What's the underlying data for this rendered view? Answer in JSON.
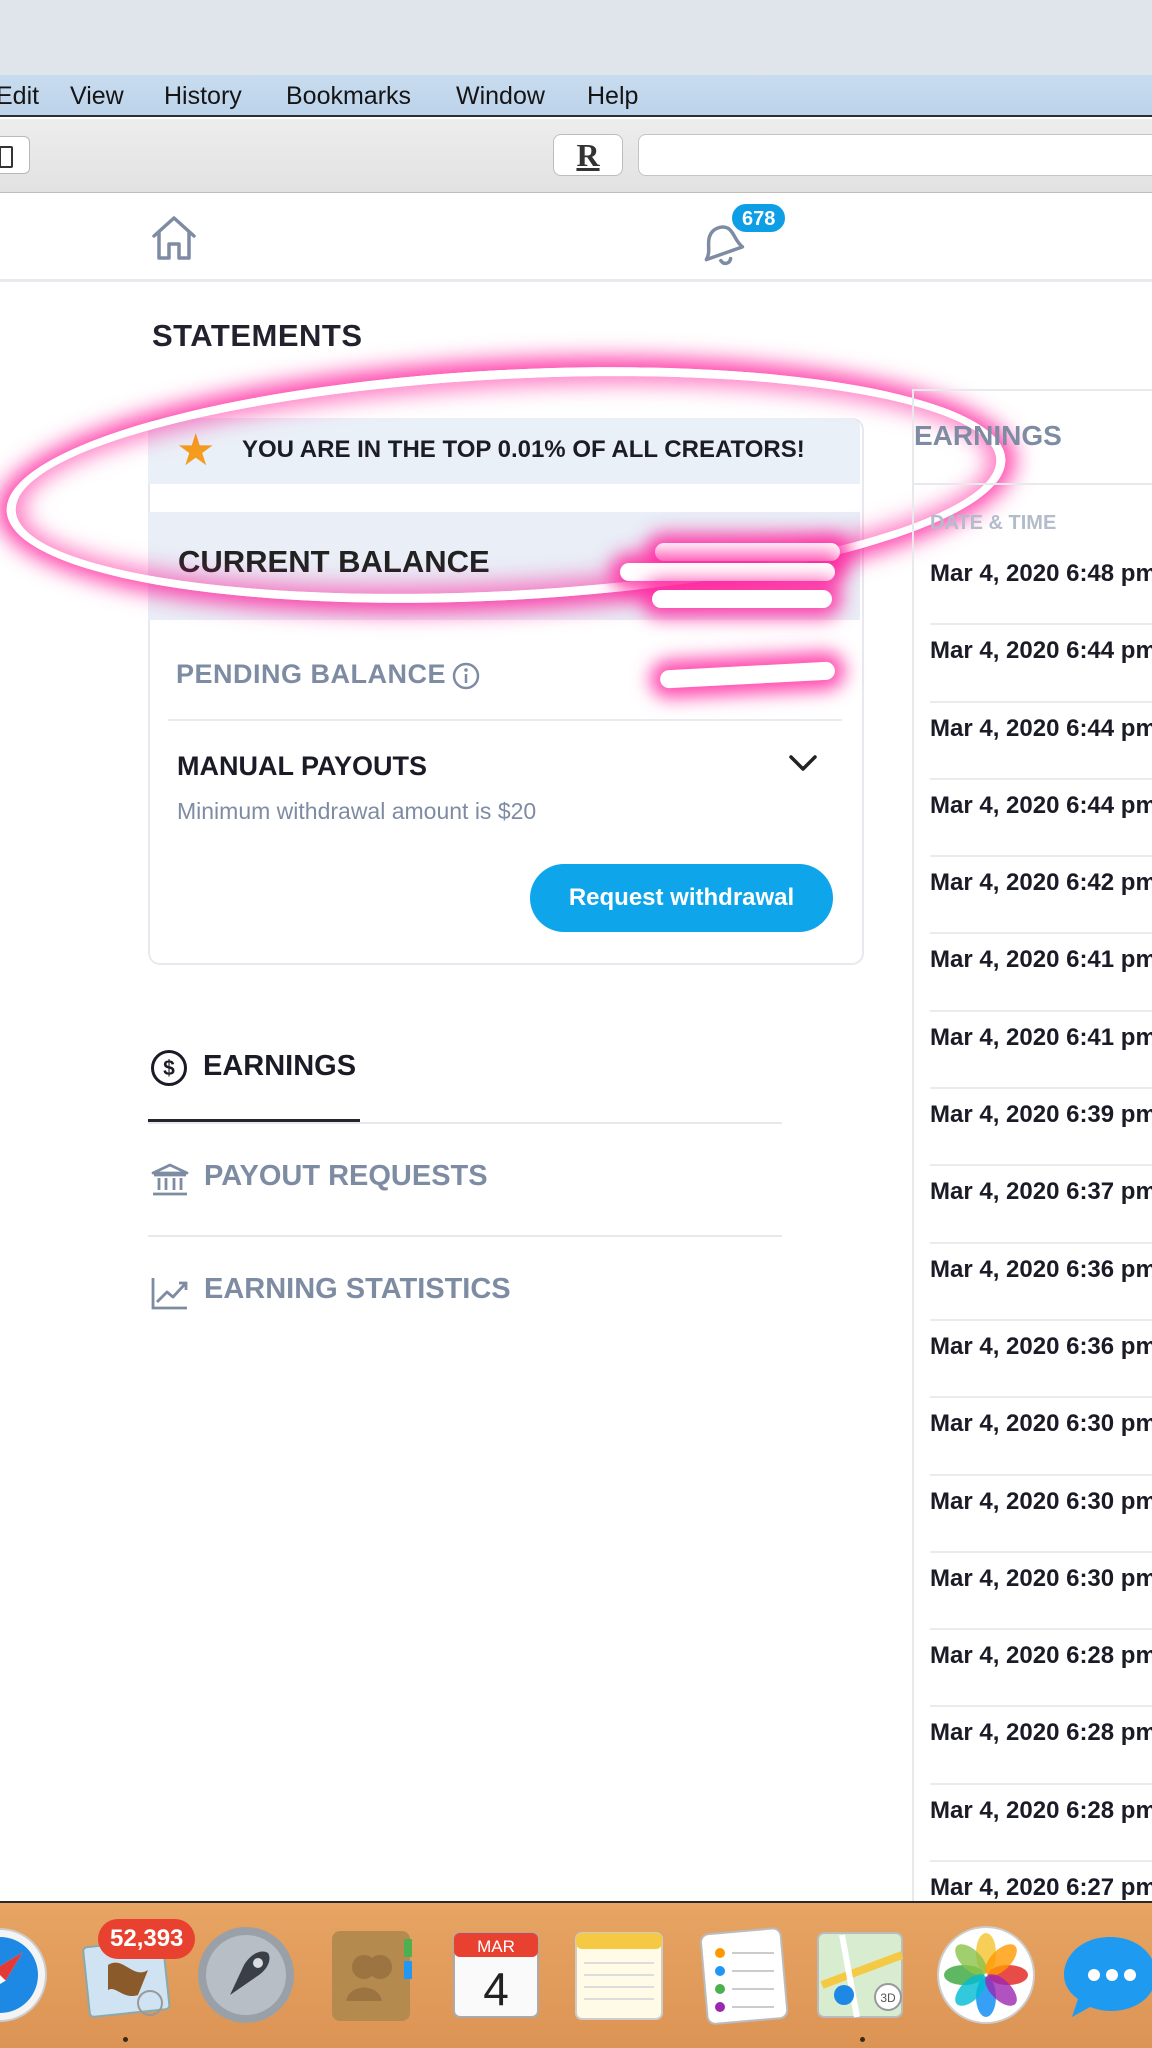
{
  "menu": {
    "items": [
      "Edit",
      "View",
      "History",
      "Bookmarks",
      "Window",
      "Help"
    ]
  },
  "toolbar": {
    "reader_label": "R"
  },
  "header": {
    "notification_count": "678"
  },
  "page": {
    "title": "STATEMENTS"
  },
  "balance_card": {
    "top_creator_text": "YOU ARE IN THE TOP 0.01% OF ALL CREATORS!",
    "current_balance_label": "CURRENT BALANCE",
    "pending_balance_label": "PENDING BALANCE",
    "manual_payouts_label": "MANUAL PAYOUTS",
    "min_withdrawal_text": "Minimum withdrawal amount is $20",
    "request_button_label": "Request withdrawal"
  },
  "tabs": [
    {
      "label": "EARNINGS",
      "icon": "dollar-circle-icon",
      "active": true
    },
    {
      "label": "PAYOUT REQUESTS",
      "icon": "bank-icon",
      "active": false
    },
    {
      "label": "EARNING STATISTICS",
      "icon": "line-chart-icon",
      "active": false
    }
  ],
  "earnings_panel": {
    "title": "EARNINGS",
    "column_header": "DATE & TIME",
    "rows": [
      "Mar 4, 2020  6:48 pm",
      "Mar 4, 2020  6:44 pm",
      "Mar 4, 2020  6:44 pm",
      "Mar 4, 2020  6:44 pm",
      "Mar 4, 2020  6:42 pm",
      "Mar 4, 2020  6:41 pm",
      "Mar 4, 2020  6:41 pm",
      "Mar 4, 2020  6:39 pm",
      "Mar 4, 2020  6:37 pm",
      "Mar 4, 2020  6:36 pm",
      "Mar 4, 2020  6:36 pm",
      "Mar 4, 2020  6:30 pm",
      "Mar 4, 2020  6:30 pm",
      "Mar 4, 2020  6:30 pm",
      "Mar 4, 2020  6:28 pm",
      "Mar 4, 2020  6:28 pm",
      "Mar 4, 2020  6:28 pm",
      "Mar 4, 2020  6:27 pm"
    ]
  },
  "dock": {
    "mail_badge": "52,393",
    "calendar_month": "MAR",
    "calendar_day": "4",
    "apps": [
      "safari-icon",
      "mail-icon",
      "launchpad-icon",
      "contacts-icon",
      "calendar-icon",
      "notes-icon",
      "reminders-icon",
      "maps-icon",
      "photos-icon",
      "messages-icon"
    ]
  },
  "colors": {
    "accent": "#0ea5ea",
    "muted_text": "#7e8ca3",
    "star": "#f39c1f",
    "highlight": "#ff1493"
  }
}
